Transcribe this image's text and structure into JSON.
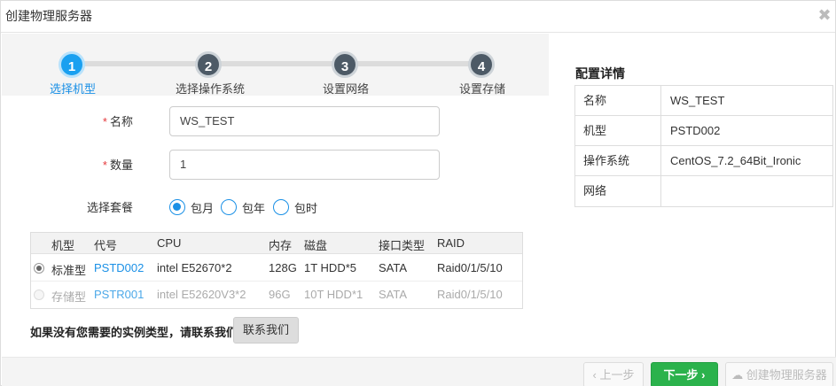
{
  "dialog": {
    "title": "创建物理服务器",
    "close_glyph": "✖"
  },
  "steps": [
    {
      "num": "1",
      "label": "选择机型"
    },
    {
      "num": "2",
      "label": "选择操作系统"
    },
    {
      "num": "3",
      "label": "设置网络"
    },
    {
      "num": "4",
      "label": "设置存储"
    }
  ],
  "form": {
    "required_mark": "*",
    "name_label": "名称",
    "name_value": "WS_TEST",
    "count_label": "数量",
    "count_value": "1",
    "plan_label": "选择套餐",
    "plan_options": [
      "包月",
      "包年",
      "包时"
    ],
    "plan_selected": "包月"
  },
  "table": {
    "headers": [
      "机型",
      "代号",
      "CPU",
      "内存",
      "磁盘",
      "接口类型",
      "RAID"
    ],
    "rows": [
      {
        "type": "标准型",
        "code": "PSTD002",
        "cpu": "intel E52670*2",
        "mem": "128G",
        "disk": "1T HDD*5",
        "iface": "SATA",
        "raid": "Raid0/1/5/10",
        "selected": true,
        "enabled": true
      },
      {
        "type": "存储型",
        "code": "PSTR001",
        "cpu": "intel E52620V3*2",
        "mem": "96G",
        "disk": "10T HDD*1",
        "iface": "SATA",
        "raid": "Raid0/1/5/10",
        "selected": false,
        "enabled": false
      }
    ]
  },
  "hint": {
    "text": "如果没有您需要的实例类型，请联系我们!",
    "contact_button": "联系我们"
  },
  "details": {
    "title": "配置详情",
    "rows": [
      {
        "key": "名称",
        "value": "WS_TEST"
      },
      {
        "key": "机型",
        "value": "PSTD002"
      },
      {
        "key": "操作系统",
        "value": "CentOS_7.2_64Bit_Ironic"
      },
      {
        "key": "网络",
        "value": ""
      }
    ]
  },
  "footer": {
    "prev_label": "‹ 上一步",
    "next_label": "下一步  ›",
    "create_label": "☁ 创建物理服务器"
  },
  "colors": {
    "accent": "#1a90e6",
    "next_green": "#2bb24c",
    "required": "#e4393c"
  }
}
